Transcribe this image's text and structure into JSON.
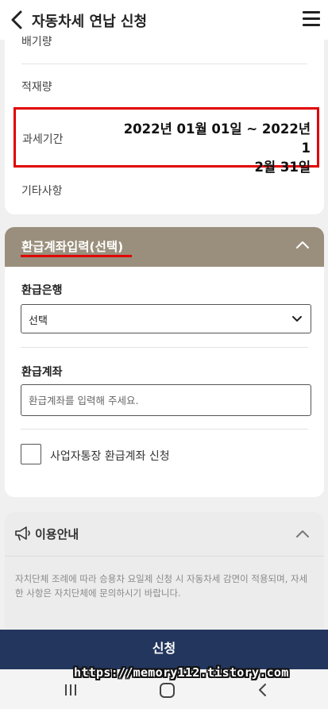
{
  "header": {
    "title": "자동차세 연납 신청",
    "back_icon": "chevron-left-icon",
    "menu_icon": "hamburger-menu-icon"
  },
  "details": {
    "rows": [
      {
        "label": "배기량"
      },
      {
        "label": "적재량"
      },
      {
        "label": "과세기간",
        "value_line1": "2022년 01월 01일 ~ 2022년 1",
        "value_line2": "2월 31일"
      },
      {
        "label": "기타사항"
      }
    ]
  },
  "refund": {
    "section_title": "환급계좌입력(선택)",
    "bank_label": "환급은행",
    "bank_selected": "선택",
    "account_label": "환급계좌",
    "account_placeholder": "환급계좌를 입력해 주세요.",
    "account_value": "",
    "business_account_label": "사업자통장 환급계좌 신청",
    "business_account_checked": false
  },
  "notice": {
    "title": "이용안내",
    "icon": "megaphone-icon",
    "text": "자치단체 조례에 따라 승용차 요일제 신청 시 자동차세 감면이 적용되며, 자세한 사항은 자치단체에 문의하시기 바랍니다."
  },
  "submit_label": "신청",
  "watermark": "https://memory112.tistory.com",
  "colors": {
    "section_header": "#9a8f7c",
    "submit_button": "#23365e",
    "highlight": "#e00000"
  }
}
